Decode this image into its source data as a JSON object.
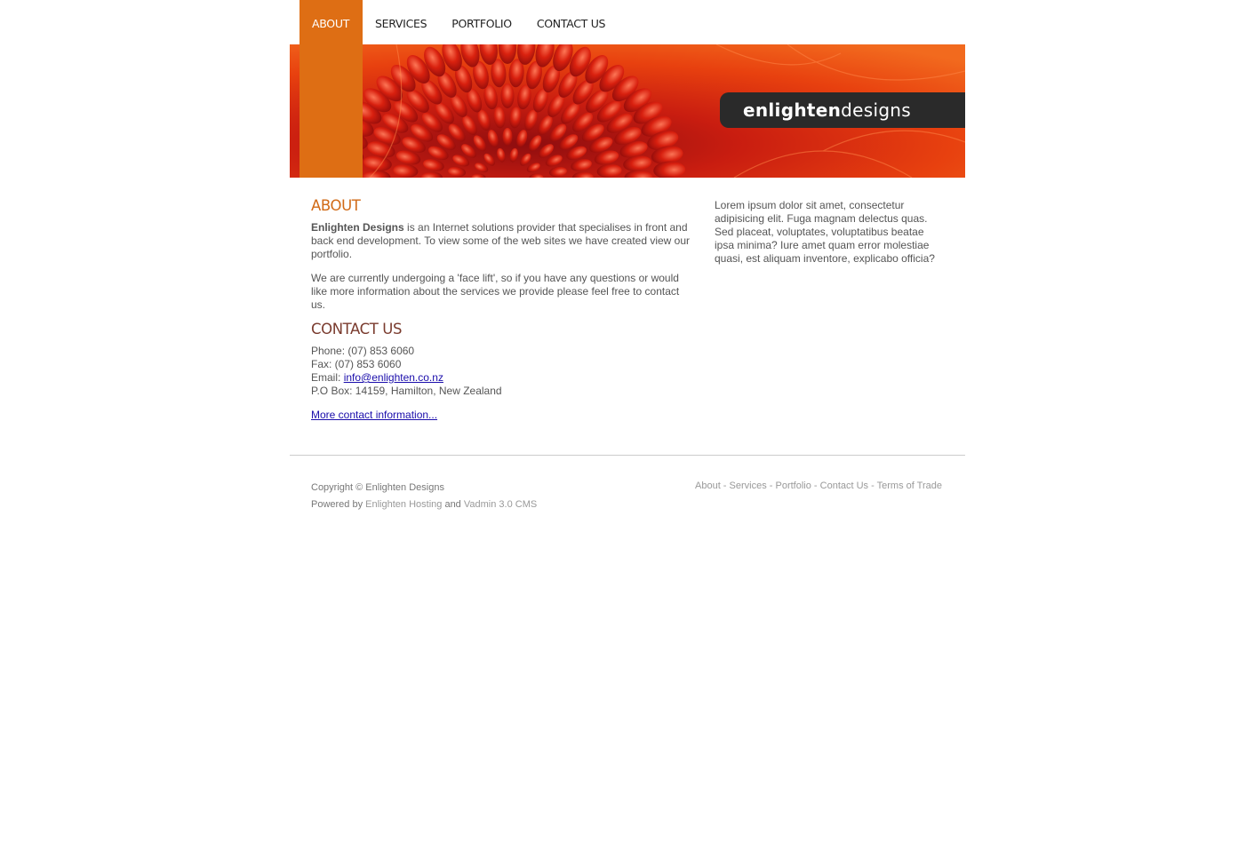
{
  "nav": {
    "items": [
      {
        "label": "ABOUT",
        "active": true
      },
      {
        "label": "SERVICES",
        "active": false
      },
      {
        "label": "PORTFOLIO",
        "active": false
      },
      {
        "label": "CONTACT US",
        "active": false
      }
    ]
  },
  "header": {
    "logo_bold": "enlighten",
    "logo_light": "designs",
    "accent_color": "#de6e14",
    "banner_color": "#c4260a"
  },
  "about": {
    "heading": "ABOUT",
    "company": "Enlighten Designs",
    "para1_rest": " is an Internet solutions provider that specialises in front and back end development. To view some of the web sites we have created view our portfolio.",
    "para2": "We are currently undergoing a 'face lift', so if you have any questions or would like more information about the services we provide please feel free to contact us."
  },
  "contact": {
    "heading": "CONTACT US",
    "phone": "Phone: (07) 853 6060",
    "fax": "Fax: (07) 853 6060",
    "email_label": "Email: ",
    "email": "info@enlighten.co.nz",
    "po_box": "P.O Box: 14159, Hamilton, New Zealand",
    "more_link": "More contact information..."
  },
  "sidebar": {
    "text": "Lorem ipsum dolor sit amet, consectetur adipisicing elit. Fuga magnam delectus quas. Sed placeat, voluptates, voluptatibus beatae ipsa minima? Iure amet quam error molestiae quasi, est aliquam inventore, explicabo officia?"
  },
  "footer": {
    "copyright": "Copyright © Enlighten Designs",
    "powered_by": "Powered by ",
    "hosting": "Enlighten Hosting",
    "and": " and ",
    "cms": "Vadmin 3.0 CMS",
    "links": [
      "About",
      "Services",
      "Portfolio",
      "Contact Us",
      "Terms of Trade"
    ],
    "separator": " - "
  }
}
